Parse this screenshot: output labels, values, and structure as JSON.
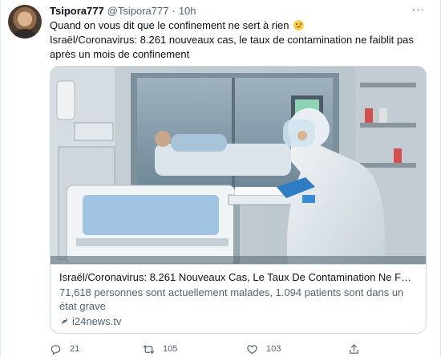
{
  "tweet": {
    "author_name": "Tsipora777",
    "author_handle": "@Tsipora777",
    "separator": "·",
    "time": "10h",
    "more_label": "···",
    "text_line1": "Quand on vous dit que le confinement ne sert à rien",
    "text_line2": "Israël/Coronavirus: 8.261 nouveaux cas, le taux de contamination ne faiblit pas après un mois de confinement"
  },
  "card": {
    "title": "Israël/Coronavirus: 8.261 Nouveaux Cas, Le Taux De Contamination Ne Faibl...",
    "description": "71,618 personnes sont actuellement malades, 1.094 patients sont dans un état grave",
    "domain": "i24news.tv",
    "image_subject": "hospital-icu-photo"
  },
  "actions": {
    "replies": "21",
    "retweets": "105",
    "likes": "103"
  },
  "icons": {
    "reply": "reply-icon",
    "retweet": "retweet-icon",
    "like": "heart-icon",
    "share": "share-icon",
    "link": "link-icon",
    "emoji": "slightly-frowning-face-emoji"
  },
  "colors": {
    "text_primary": "#0f1419",
    "text_secondary": "#536471",
    "border": "#cfd9de",
    "emoji_face": "#ffcc4d"
  }
}
